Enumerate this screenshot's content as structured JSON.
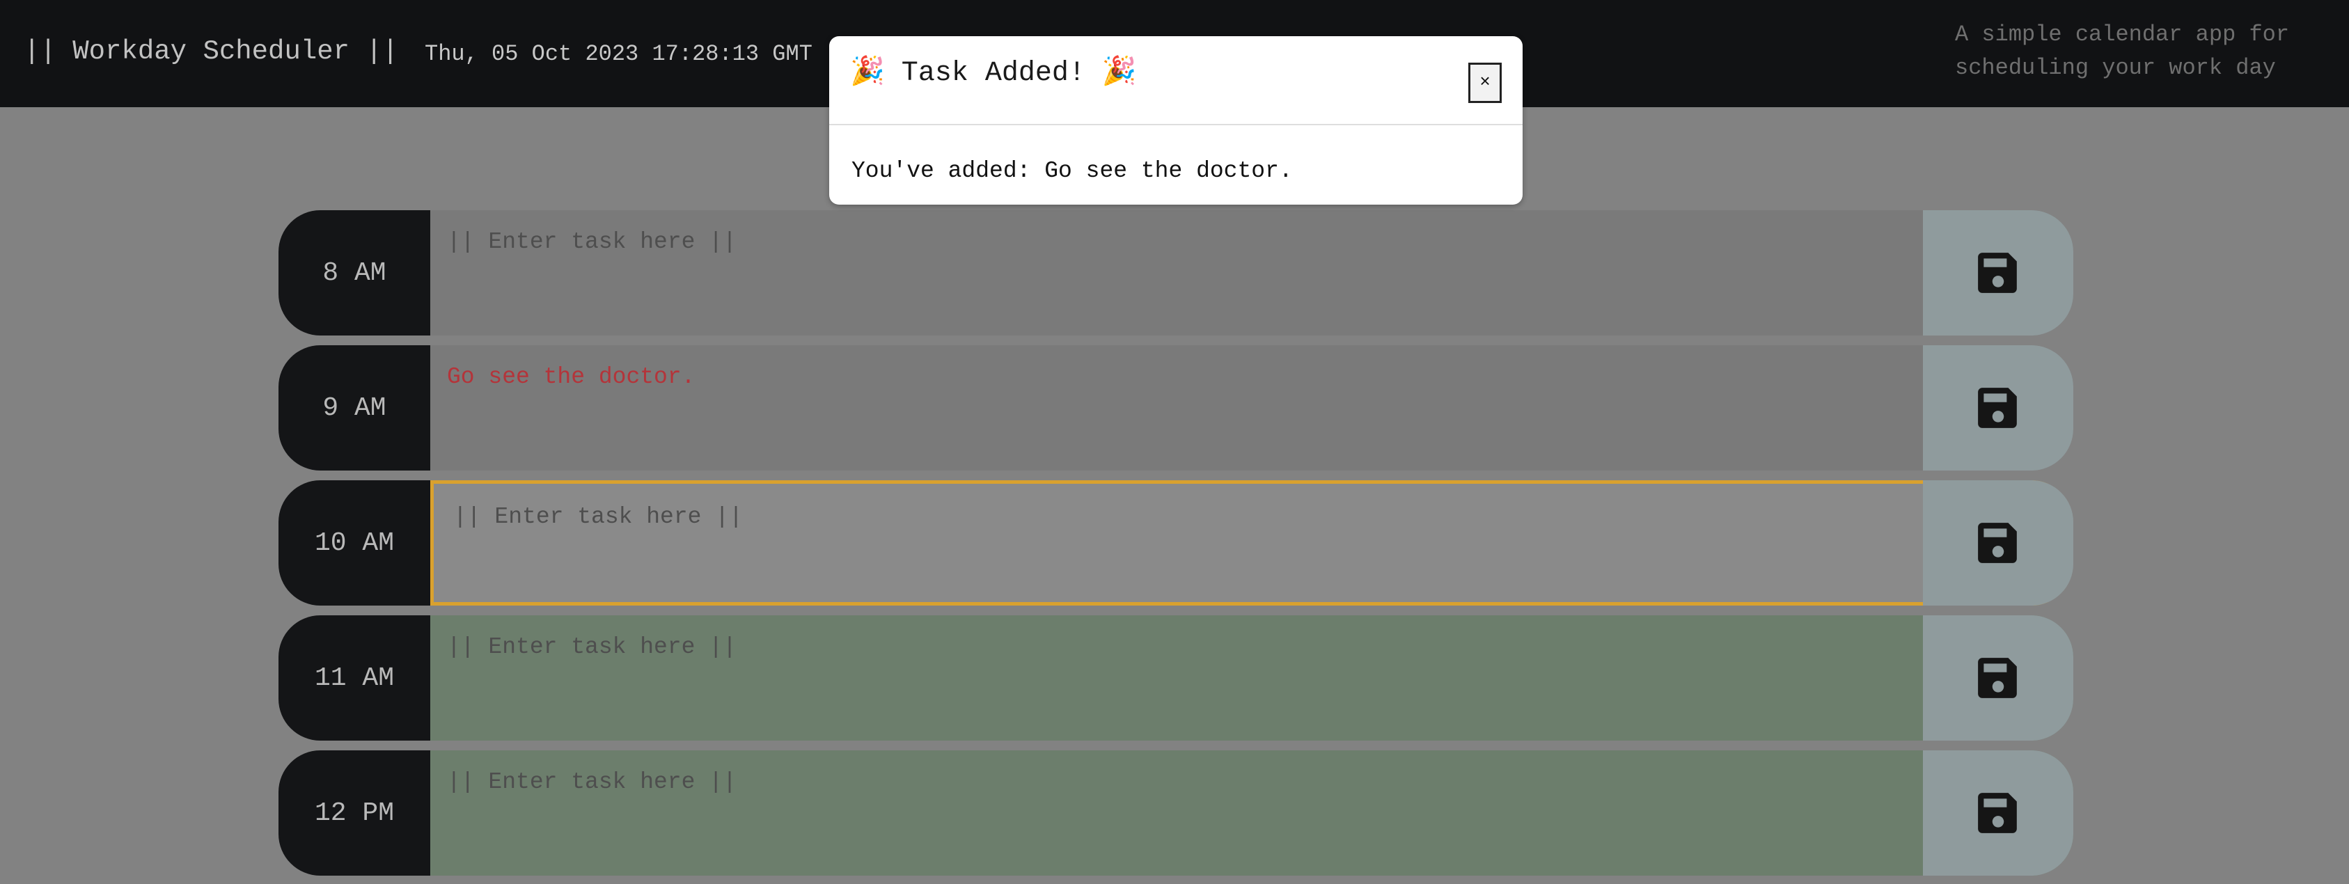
{
  "header": {
    "title": "|| Workday Scheduler ||",
    "datetime": "Thu, 05 Oct 2023 17:28:13 GMT",
    "tagline": "A simple calendar app for scheduling your work day"
  },
  "rows": [
    {
      "hour": "8 AM",
      "value": "",
      "placeholder": "|| Enter task here ||",
      "state": "past"
    },
    {
      "hour": "9 AM",
      "value": "Go see the doctor.",
      "placeholder": "|| Enter task here ||",
      "state": "past"
    },
    {
      "hour": "10 AM",
      "value": "",
      "placeholder": "|| Enter task here ||",
      "state": "present"
    },
    {
      "hour": "11 AM",
      "value": "",
      "placeholder": "|| Enter task here ||",
      "state": "future"
    },
    {
      "hour": "12 PM",
      "value": "",
      "placeholder": "|| Enter task here ||",
      "state": "future"
    }
  ],
  "modal": {
    "title": "🎉 Task Added! 🎉",
    "close_label": "×",
    "message": "You've added: Go see the doctor."
  },
  "colors": {
    "header_bg": "#111214",
    "present_border": "#d9a12e",
    "added_task_text": "#b4343a",
    "future_bg": "#6c7e6c",
    "past_bg": "#7a7a7a",
    "save_bg": "#8f9b9d"
  },
  "icons": {
    "save": "floppy-disk-icon",
    "close": "close-icon"
  }
}
